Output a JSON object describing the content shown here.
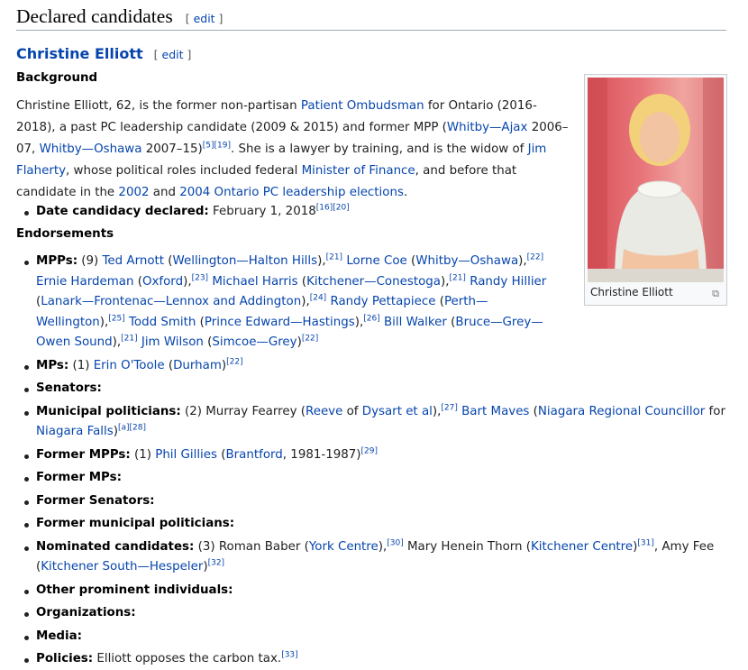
{
  "section": {
    "title": "Declared candidates",
    "edit": "edit"
  },
  "candidate": {
    "name": "Christine Elliott",
    "edit": "edit"
  },
  "headings": {
    "background": "Background",
    "endorsements": "Endorsements"
  },
  "bio": {
    "s1": "Christine Elliott, 62, is the former non-partisan ",
    "l1": "Patient Ombudsman",
    "s2": " for Ontario (2016-2018), a past PC leadership candidate (2009 & 2015) and former MPP (",
    "l2": "Whitby—Ajax",
    "s3": " 2006–07, ",
    "l3": "Whitby—Oshawa",
    "s4": " 2007–15)",
    "r1": "[5][19]",
    "s5": ". She is a lawyer by training, and is the widow of ",
    "l4": "Jim Flaherty",
    "s6": ", whose political roles included federal ",
    "l5": "Minister of Finance",
    "s7": ", and before that candidate in the ",
    "l6": "2002",
    "s8": " and ",
    "l7": "2004 Ontario PC leadership elections",
    "s9": "."
  },
  "declared": {
    "label": "Date candidacy declared:",
    "value": " February 1, 2018",
    "refs": "[16][20]"
  },
  "endorsements": {
    "mpps": {
      "label": "MPPs:",
      "count": " (9) ",
      "e1": "Ted Arnott",
      "d1": "Wellington—Halton Hills",
      "r1": "[21]",
      "e2": "Lorne Coe",
      "d2": "Whitby—Oshawa",
      "r2": "[22]",
      "e3": "Ernie Hardeman",
      "d3": "Oxford",
      "r3": "[23]",
      "e4": "Michael Harris",
      "d4": "Kitchener—Conestoga",
      "r4": "[21]",
      "e5": "Randy Hillier",
      "d5": "Lanark—Frontenac—Lennox and Addington",
      "r5": "[24]",
      "e6": "Randy Pettapiece",
      "d6": "Perth—Wellington",
      "r6": "[25]",
      "e7": "Todd Smith",
      "d7": "Prince Edward—Hastings",
      "r7": "[26]",
      "e8": "Bill Walker",
      "d8": "Bruce—Grey—Owen Sound",
      "r8": "[21]",
      "e9": "Jim Wilson",
      "d9": "Simcoe—Grey",
      "r9": "[22]"
    },
    "mps": {
      "label": "MPs:",
      "count": " (1) ",
      "e1": "Erin O'Toole",
      "d1": "Durham",
      "r1": "[22]"
    },
    "senators": "Senators:",
    "municipal": {
      "label": "Municipal politicians:",
      "count": " (2) Murray Fearrey (",
      "reeve": "Reeve",
      "of": " of ",
      "dysart": "Dysart et al",
      "r1": "[27]",
      "e2": "Bart Maves",
      "nrc": "Niagara Regional Councillor",
      "for": " for ",
      "falls": "Niagara Falls",
      "r2": "[a][28]"
    },
    "former_mpps": {
      "label": "Former MPPs:",
      "count": " (1) ",
      "e1": "Phil Gillies",
      "d1": "Brantford",
      "years": ", 1981-1987)",
      "r1": "[29]"
    },
    "former_mps": "Former MPs:",
    "former_senators": "Former Senators:",
    "former_municipal": "Former municipal politicians:",
    "nominated": {
      "label": "Nominated candidates:",
      "count": " (3) Roman Baber (",
      "d1": "York Centre",
      "r1": "[30]",
      "n2": " Mary Henein Thorn (",
      "d2": "Kitchener Centre",
      "r2": "[31]",
      "n3": ", Amy Fee (",
      "d3": "Kitchener South—Hespeler",
      "r3": "[32]"
    },
    "other": "Other prominent individuals:",
    "orgs": "Organizations:",
    "media": "Media:",
    "policies": {
      "label": "Policies:",
      "text": " Elliott opposes the carbon tax.",
      "r1": "[33]"
    }
  },
  "image": {
    "caption": "Christine Elliott"
  }
}
